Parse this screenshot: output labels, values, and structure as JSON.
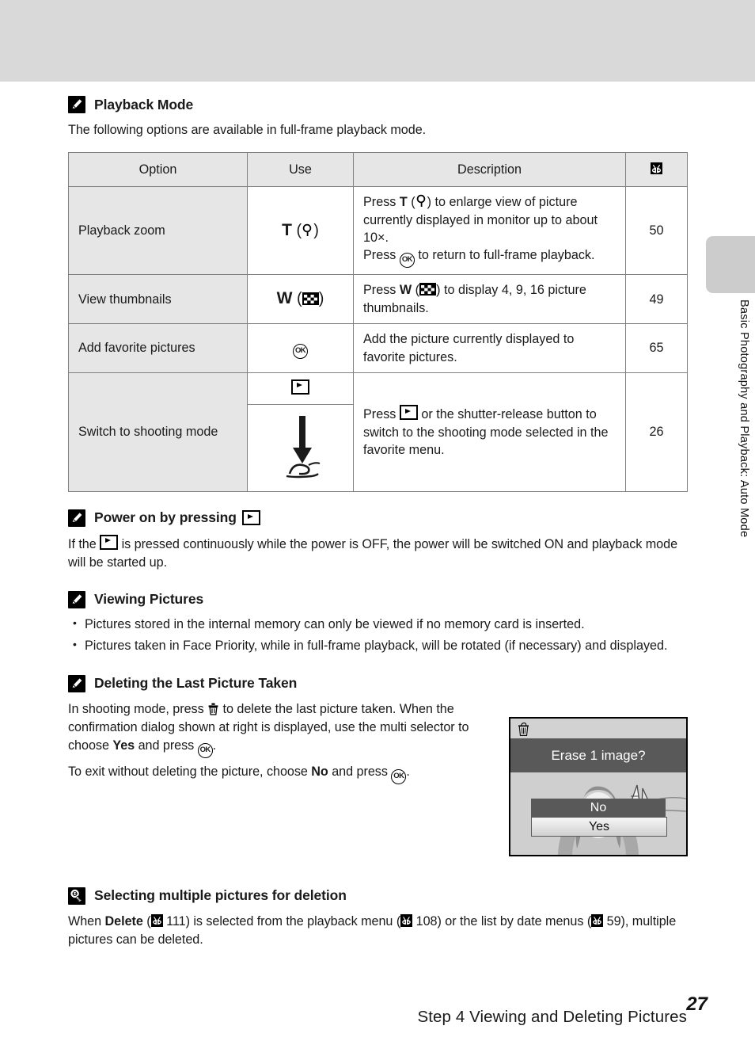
{
  "header": {
    "running_title": "Step 4 Viewing and Deleting Pictures"
  },
  "side_tab": {
    "label": "Basic Photography and Playback: Auto Mode"
  },
  "playback_mode": {
    "icon": "note-pencil-icon",
    "title": "Playback Mode",
    "intro": "The following options are available in full-frame playback mode.",
    "table": {
      "columns": [
        "Option",
        "Use",
        "Description",
        "page-reference-icon"
      ],
      "rows": [
        {
          "option": "Playback zoom",
          "use_key": "T",
          "use_icon": "magnifier-icon",
          "description_lines": [
            "Press T (magnifier-icon) to enlarge view of picture currently displayed in monitor up to about 10×.",
            "Press OK to return to full-frame playback."
          ],
          "desc_part1_a": "Press ",
          "desc_part1_b": " (",
          "desc_part1_c": ") to enlarge view of picture currently displayed in monitor up to about 10×.",
          "desc_part2_a": "Press ",
          "desc_part2_b": " to return to full-frame playback.",
          "page": "50"
        },
        {
          "option": "View thumbnails",
          "use_key": "W",
          "use_icon": "thumbnail-grid-icon",
          "desc_part1_a": "Press ",
          "desc_part1_b": " (",
          "desc_part1_c": ") to display 4, 9, 16 picture thumbnails.",
          "page": "49"
        },
        {
          "option": "Add favorite pictures",
          "use_key": "",
          "use_icon": "ok-button-icon",
          "desc_part1_a": "Add the picture currently displayed to favorite pictures.",
          "page": "65"
        },
        {
          "option": "Switch to shooting mode",
          "use_key": "",
          "use_icon": "playback-button-icon",
          "use_icon2": "shutter-release-press-icon",
          "desc_part1_a": "Press ",
          "desc_part1_b": " or the shutter-release button to switch to the shooting mode selected in the favorite menu.",
          "page": "26"
        }
      ]
    }
  },
  "power_on": {
    "icon": "note-pencil-icon",
    "title_prefix": "Power on by pressing ",
    "title_icon": "playback-button-icon",
    "body_a": "If the ",
    "body_b": " is pressed continuously while the power is OFF, the power will be switched ON and playback mode will be started up."
  },
  "viewing_pictures": {
    "icon": "note-pencil-icon",
    "title": "Viewing Pictures",
    "bullets": [
      "Pictures stored in the internal memory can only be viewed if no memory card is inserted.",
      "Pictures taken in Face Priority, while in full-frame playback, will be rotated (if necessary) and displayed."
    ]
  },
  "deleting_last": {
    "icon": "note-pencil-icon",
    "title": "Deleting the Last Picture Taken",
    "p1_a": "In shooting mode, press ",
    "p1_b": " to delete the last picture taken. When the confirmation dialog shown at right is displayed, use the multi selector to choose ",
    "p1_yes": "Yes",
    "p1_c": " and press ",
    "p1_d": ".",
    "p2_a": "To exit without deleting the picture, choose ",
    "p2_no": "No",
    "p2_b": " and press ",
    "p2_c": "."
  },
  "monitor": {
    "trash_icon": "trash-icon",
    "title": "Erase 1 image?",
    "option_no": "No",
    "option_yes": "Yes",
    "selected": "Yes"
  },
  "selecting_multiple": {
    "icon": "tip-lightbulb-icon",
    "title": "Selecting multiple pictures for deletion",
    "p_a": "When ",
    "p_delete": "Delete",
    "p_b": " (",
    "p_ref1": "111",
    "p_c": ") is selected from the playback menu (",
    "p_ref2": "108",
    "p_d": ") or the list by date menus (",
    "p_ref3": "59",
    "p_e": "), multiple pictures can be deleted."
  },
  "footer": {
    "page_number": "27"
  },
  "colors": {
    "header_band": "#d9d9d9",
    "table_shade": "#e6e6e6",
    "table_border": "#808080",
    "monitor_band": "#595959",
    "side_tab": "#cccccc"
  }
}
